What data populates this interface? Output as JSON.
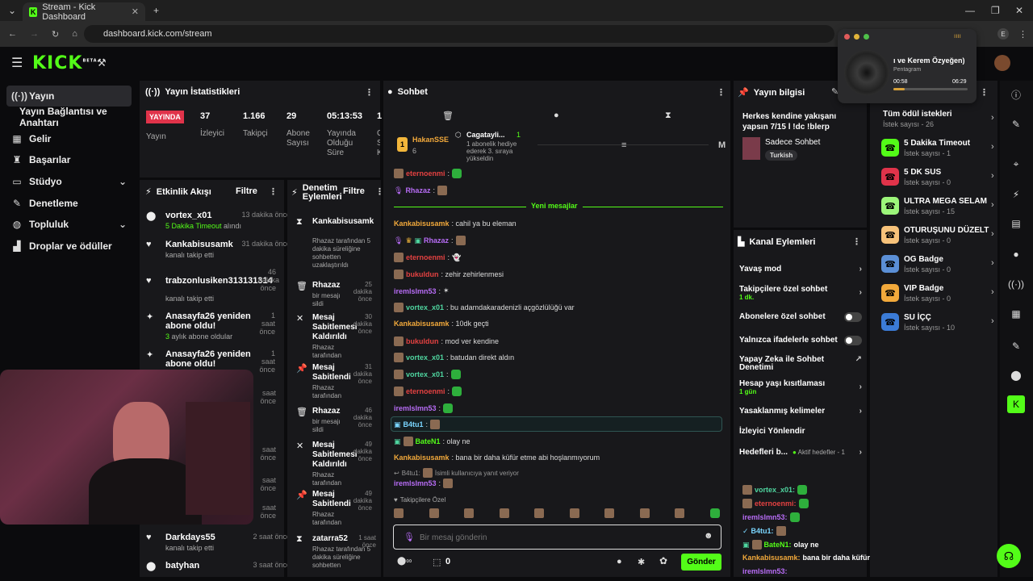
{
  "browser": {
    "tab_title": "Stream - Kick Dashboard",
    "url": "dashboard.kick.com/stream",
    "profile": "E"
  },
  "logo": "KICK",
  "logo_badge": "BETA",
  "nav": [
    {
      "label": "Yayın",
      "icon": "broadcast-icon"
    },
    {
      "label": "Yayın Bağlantısı ve Anahtarı",
      "icon": ""
    },
    {
      "label": "Gelir",
      "icon": "revenue-icon"
    },
    {
      "label": "Başarılar",
      "icon": "trophy-icon"
    },
    {
      "label": "Stüdyo",
      "icon": "studio-icon"
    },
    {
      "label": "Denetleme",
      "icon": "wrench-icon"
    },
    {
      "label": "Topluluk",
      "icon": "community-icon"
    },
    {
      "label": "Droplar ve ödüller",
      "icon": "drops-icon"
    }
  ],
  "stats": {
    "title": "Yayın İstatistikleri",
    "live": "YAYINDA",
    "live_label": "Yayın",
    "viewers": "37",
    "viewers_label": "İzleyici",
    "followers": "1.166",
    "followers_label": "Takipçi",
    "subs": "29",
    "subs_label": "Abone Sayısı",
    "duration": "05:13:53",
    "duration_label": "Yayında Olduğu Süre",
    "extra": "1",
    "extra_label": "C S K"
  },
  "activity": {
    "title": "Etkinlik Akışı",
    "filter": "Filtre",
    "items": [
      {
        "name": "vortex_x01",
        "sub": "5 Dakika Timeout",
        "sub2": " alındı",
        "time": "13 dakika önce"
      },
      {
        "name": "Kankabisusamk",
        "sub": "kanalı takip etti",
        "sub2": "",
        "time": "31 dakika önce"
      },
      {
        "name": "trabzonlusiken313131314",
        "sub": "kanalı takip etti",
        "sub2": "",
        "time": "46 dakika önce"
      },
      {
        "name": "Anasayfa26 yeniden abone oldu!",
        "sub": "3",
        "sub2": " aylık abone oldular",
        "time": "1 saat önce"
      },
      {
        "name": "Anasayfa26 yeniden abone oldu!",
        "sub": "",
        "sub2": "",
        "time": "1 saat önce"
      },
      {
        "name": "",
        "sub": "",
        "sub2": "",
        "time": "saat önce"
      },
      {
        "name": "",
        "sub": "",
        "sub2": "",
        "time": "saat önce"
      },
      {
        "name": "",
        "sub": "",
        "sub2": "",
        "time": "saat önce"
      },
      {
        "name": "",
        "sub": "",
        "sub2": "",
        "time": "saat önce"
      },
      {
        "name": "Darkdays55",
        "sub": "kanalı takip etti",
        "sub2": "",
        "time": "2 saat önce"
      },
      {
        "name": "batyhan",
        "sub": "",
        "sub2": "",
        "time": "3 saat önce"
      }
    ]
  },
  "moderation": {
    "title": "Denetim Eylemleri",
    "filter": "Filtre",
    "items": [
      {
        "title": "Kankabisusamk",
        "sub": "",
        "time": ""
      },
      {
        "title": "",
        "sub": "Rhazaz tarafından 5 dakika süreliğine sohbetten uzaklaştırıldı",
        "time": ""
      },
      {
        "title": "Rhazaz",
        "sub": "bir mesajı sildi",
        "time": "25 dakika önce"
      },
      {
        "title": "Mesaj Sabitlemesi Kaldırıldı",
        "sub": "Rhazaz tarafından",
        "time": "30 dakika önce"
      },
      {
        "title": "Mesaj Sabitlendi",
        "sub": "Rhazaz tarafından",
        "time": "31 dakika önce"
      },
      {
        "title": "Rhazaz",
        "sub": "bir mesajı sildi",
        "time": "46 dakika önce"
      },
      {
        "title": "Mesaj Sabitlemesi Kaldırıldı",
        "sub": "Rhazaz tarafından",
        "time": "49 dakika önce"
      },
      {
        "title": "Mesaj Sabitlendi",
        "sub": "Rhazaz tarafından",
        "time": "49 dakika önce"
      },
      {
        "title": "zatarra52",
        "sub": "Rhazaz tarafından 5 dakika süreliğine sohbetten",
        "time": "1 saat önce"
      }
    ]
  },
  "chat": {
    "title": "Sohbet",
    "pinned_user": "HakanSSE",
    "pinned_count": "6",
    "gift_user": "Cagatayli...",
    "gift_text": "1 abonelik hediye ederek 3. sıraya yükseldin",
    "gift_count": "1",
    "new_messages": "Yeni mesajlar",
    "messages": [
      {
        "user": "eternoenmi",
        "text": "",
        "color": "#e34141"
      },
      {
        "user": "Rhazaz",
        "text": "",
        "color": "#b76cf5"
      },
      {
        "user": "Kankabisusamk",
        "text": ": cahil ya bu eleman",
        "color": "#f2a93b"
      },
      {
        "user": "Rhazaz",
        "text": "",
        "color": "#b76cf5"
      },
      {
        "user": "eternoenmi",
        "text": "",
        "color": "#e34141"
      },
      {
        "user": "bukuldun",
        "text": ": zehir zehirlenmesi",
        "color": "#e34141"
      },
      {
        "user": "iremlslmn53",
        "text": "",
        "color": "#b76cf5"
      },
      {
        "user": "vortex_x01",
        "text": ": bu adamdakaradenizli açgözlülüğü var",
        "color": "#4fd6a0"
      },
      {
        "user": "Kankabisusamk",
        "text": ": 10dk geçti",
        "color": "#f2a93b"
      },
      {
        "user": "bukuldun",
        "text": ": mod ver kendine",
        "color": "#e34141"
      },
      {
        "user": "vortex_x01",
        "text": ": batudan direkt aldın",
        "color": "#4fd6a0"
      },
      {
        "user": "vortex_x01",
        "text": "",
        "color": "#4fd6a0"
      },
      {
        "user": "eternoenmi",
        "text": "",
        "color": "#e34141"
      },
      {
        "user": "iremlslmn53",
        "text": "",
        "color": "#b76cf5"
      },
      {
        "user": "B4tu1",
        "text": "",
        "color": "#7ad6ff"
      },
      {
        "user": "BateN1",
        "text": ": olay ne",
        "color": "#53fc18"
      },
      {
        "user": "Kankabisusamk",
        "text": ": bana bir daha küfür etme abi hoşlanmıyorum",
        "color": "#f2a93b"
      },
      {
        "user": "iremlslmn53",
        "text": "",
        "color": "#b76cf5"
      }
    ],
    "reply_user": "B4tu1:",
    "reply_text": "İsimli kullanıcıya yanıt veriyor",
    "followers_only": "Takipçilere Özel",
    "placeholder": "Bir mesaj gönderin",
    "points": "0",
    "send": "Gönder"
  },
  "stream_info": {
    "title": "Yayın bilgisi",
    "stream_title": "Herkes kendine yakışanı yapsın 7/15 l !dc !blerp",
    "category": "Sadece Sohbet",
    "tag": "Turkish"
  },
  "channel_actions": {
    "title": "Kanal Eylemleri",
    "rows": [
      {
        "label": "Yavaş mod",
        "sub": ""
      },
      {
        "label": "Takipçilere özel sohbet",
        "sub": "1 dk."
      },
      {
        "label": "Abonelere özel sohbet",
        "sub": ""
      },
      {
        "label": "Yalnızca ifadelerle sohbet",
        "sub": ""
      },
      {
        "label": "Yapay Zeka ile Sohbet Denetimi",
        "sub": ""
      },
      {
        "label": "Hesap yaşı kısıtlaması",
        "sub": "1 gün"
      },
      {
        "label": "Yasaklanmış kelimeler",
        "sub": ""
      },
      {
        "label": "İzleyici Yönlendir",
        "sub": ""
      },
      {
        "label": "Hedefleri b...",
        "sub": "Aktif hedefler - 1"
      }
    ]
  },
  "overlay_chat": [
    {
      "user": "vortex_x01:",
      "text": "",
      "color": "#4fd6a0"
    },
    {
      "user": "eternoenmi:",
      "text": "",
      "color": "#e34141"
    },
    {
      "user": "iremlslmn53:",
      "text": "",
      "color": "#b76cf5"
    },
    {
      "user": "B4tu1:",
      "text": "",
      "color": "#7ad6ff"
    },
    {
      "user": "BateN1:",
      "text": " olay ne",
      "color": "#53fc18"
    },
    {
      "user": "Kankabisusamk:",
      "text": " bana bir daha küfür etme abi hoşlanmıyorum",
      "color": "#f2a93b"
    },
    {
      "user": "iremlslmn53:",
      "text": "",
      "color": "#b76cf5"
    }
  ],
  "rewards": {
    "all": "Tüm ödül istekleri",
    "all_sub": "İstek sayısı - 26",
    "items": [
      {
        "name": "5 Dakika Timeout",
        "sub": "İstek sayısı - 1",
        "color": "#53fc18"
      },
      {
        "name": "5 DK SUS",
        "sub": "İstek sayısı - 0",
        "color": "#e0334a"
      },
      {
        "name": "ULTRA MEGA SELAM",
        "sub": "İstek sayısı - 15",
        "color": "#9cf57a"
      },
      {
        "name": "OTURUŞUNU DÜZELT",
        "sub": "İstek sayısı - 0",
        "color": "#f7c27a"
      },
      {
        "name": "OG Badge",
        "sub": "İstek sayısı - 0",
        "color": "#5b8fd6"
      },
      {
        "name": "VIP Badge",
        "sub": "İstek sayısı - 0",
        "color": "#f2a93b"
      },
      {
        "name": "SU İÇÇ",
        "sub": "İstek sayısı - 10",
        "color": "#3b7bd6"
      }
    ]
  },
  "music": {
    "title": "ı ve Kerem Özyeğen)",
    "artist": "Pentagram",
    "elapsed": "00:58",
    "total": "06:29",
    "progress": 0.15
  }
}
